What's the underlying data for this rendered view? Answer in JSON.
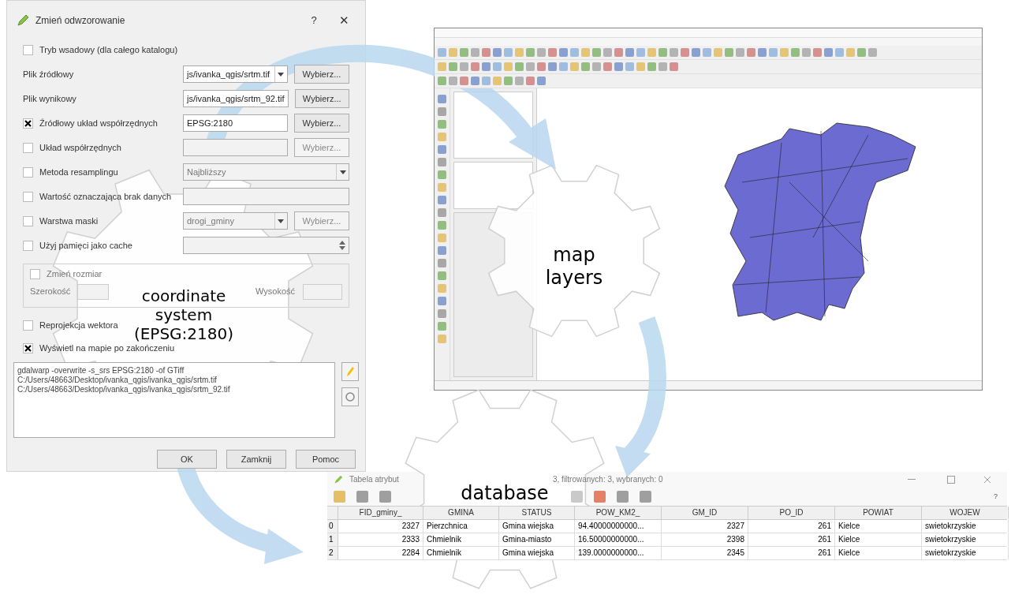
{
  "dialog": {
    "title": "Zmień odwzorowanie",
    "help": "?",
    "close": "✕",
    "rows": [
      {
        "kind": "checkbox",
        "label": "Tryb wsadowy (dla całego katalogu)",
        "checked": false
      },
      {
        "kind": "label",
        "label": "Plik źródłowy",
        "control": {
          "kind": "combo",
          "value": "js/ivanka_qgis/srtm.tif",
          "disabled": false
        },
        "button": {
          "label": "Wybierz...",
          "disabled": false
        }
      },
      {
        "kind": "label",
        "label": "Plik wynikowy",
        "control": {
          "kind": "field",
          "value": "js/ivanka_qgis/srtm_92.tif",
          "disabled": false
        },
        "button": {
          "label": "Wybierz...",
          "disabled": false
        }
      },
      {
        "kind": "checkbox",
        "label": "Źródłowy układ współrzędnych",
        "checked": true,
        "control": {
          "kind": "field",
          "value": "EPSG:2180",
          "disabled": false
        },
        "button": {
          "label": "Wybierz...",
          "disabled": false
        }
      },
      {
        "kind": "checkbox",
        "label": "Układ współrzędnych",
        "checked": false,
        "control": {
          "kind": "field",
          "disabled": true
        },
        "button": {
          "label": "Wybierz...",
          "disabled": true
        }
      },
      {
        "kind": "checkbox",
        "label": "Metoda resamplingu",
        "checked": false,
        "control": {
          "kind": "combo",
          "value": "Najbliższy",
          "disabled": true
        }
      },
      {
        "kind": "checkbox",
        "label": "Wartość oznaczająca brak danych",
        "checked": false,
        "control": {
          "kind": "field",
          "disabled": true
        }
      },
      {
        "kind": "checkbox",
        "label": "Warstwa maski",
        "checked": false,
        "control": {
          "kind": "combo",
          "value": "drogi_gminy",
          "disabled": true
        },
        "button": {
          "label": "Wybierz...",
          "disabled": true
        }
      },
      {
        "kind": "checkbox",
        "label": "Użyj pamięci jako cache",
        "checked": false,
        "control": {
          "kind": "spin",
          "disabled": true
        }
      }
    ],
    "resize": {
      "label": "Zmień rozmiar",
      "checked": false,
      "width_label": "Szerokość",
      "height_label": "Wysokość"
    },
    "options": [
      {
        "label": "Reprojekcja wektora",
        "checked": false
      },
      {
        "label": "Wyświetl na mapie po zakończeniu",
        "checked": true
      }
    ],
    "command": [
      "gdalwarp -overwrite -s_srs EPSG:2180 -of GTiff",
      "C:/Users/48663/Desktop/ivanka_qgis/ivanka_qgis/srtm.tif",
      "C:/Users/48663/Desktop/ivanka_qgis/ivanka_qgis/srtm_92.tif"
    ],
    "buttons": [
      "OK",
      "Zamknij",
      "Pomoc"
    ]
  },
  "attribute_table": {
    "title": [
      "Tabela atrybut",
      "3, filtrowanych: 3, wybranych: 0"
    ],
    "help": "?",
    "columns": [
      "FID_gminy_",
      "GMINA",
      "STATUS",
      "POW_KM2_",
      "GM_ID",
      "PO_ID",
      "POWIAT",
      "WOJEW"
    ],
    "rows": [
      {
        "index": "0",
        "cells": [
          "2327",
          "Pierzchnica",
          "Gmina wiejska",
          "94.40000000000...",
          "2327",
          "261",
          "Kielce",
          "swietokrzyskie"
        ]
      },
      {
        "index": "1",
        "cells": [
          "2333",
          "Chmielnik",
          "Gmina-miasto",
          "16.50000000000...",
          "2398",
          "261",
          "Kielce",
          "swietokrzyskie"
        ]
      },
      {
        "index": "2",
        "cells": [
          "2284",
          "Chmielnik",
          "Gmina wiejska",
          "139.0000000000...",
          "2345",
          "261",
          "Kielce",
          "swietokrzyskie"
        ]
      }
    ]
  },
  "gears": [
    {
      "label": "coordinate system (EPSG:2180)"
    },
    {
      "label": "map layers"
    },
    {
      "label": "database"
    }
  ]
}
